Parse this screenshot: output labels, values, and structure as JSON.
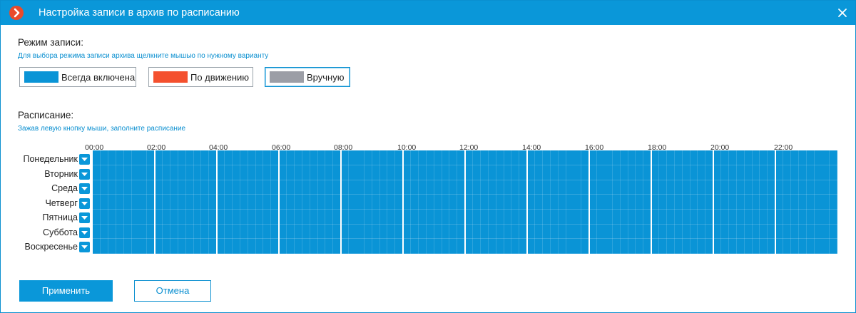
{
  "window": {
    "title": "Настройка записи в архив по расписанию"
  },
  "mode": {
    "heading": "Режим записи:",
    "hint": "Для выбора режима записи архива щелкните мышью по нужному варианту",
    "options": [
      {
        "label": "Всегда включена",
        "color": "#0a94d6"
      },
      {
        "label": "По движению",
        "color": "#f4502e"
      },
      {
        "label": "Вручную",
        "color": "#9c9ea6"
      }
    ],
    "selected": "Вручную"
  },
  "schedule": {
    "heading": "Расписание:",
    "hint": "Зажав левую кнопку мыши, заполните расписание",
    "hours": [
      "00:00",
      "02:00",
      "04:00",
      "06:00",
      "08:00",
      "10:00",
      "12:00",
      "14:00",
      "16:00",
      "18:00",
      "20:00",
      "22:00"
    ],
    "days": [
      "Понедельник",
      "Вторник",
      "Среда",
      "Четверг",
      "Пятница",
      "Суббота",
      "Воскресенье"
    ],
    "fill_mode": "Всегда включена",
    "fill_color": "#0a94d6"
  },
  "actions": {
    "apply_label": "Применить",
    "cancel_label": "Отмена"
  },
  "icons": {
    "app": "app-logo-icon",
    "close": "close-icon",
    "day_dropdown": "chevron-down-icon"
  }
}
